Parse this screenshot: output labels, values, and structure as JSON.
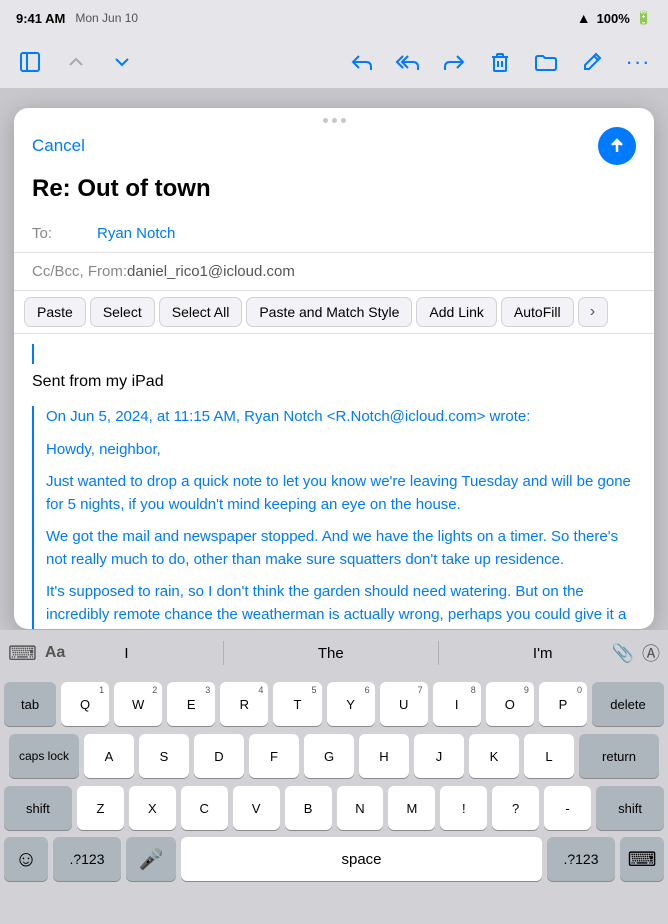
{
  "statusBar": {
    "time": "9:41 AM",
    "date": "Mon Jun 10",
    "wifi": "WiFi",
    "battery": "100%"
  },
  "toolbar": {
    "sidebarBtn": "⊟",
    "upBtn": "∧",
    "downBtn": "∨",
    "replyBtn": "↩",
    "replyAllBtn": "↩↩",
    "forwardBtn": "↪",
    "trashBtn": "🗑",
    "folderBtn": "📁",
    "composeBtn": "✏",
    "moreBtn": "⋯"
  },
  "compose": {
    "cancelLabel": "Cancel",
    "subject": "Re: Out of town",
    "toLabel": "To:",
    "toValue": "Ryan Notch",
    "ccLabel": "Cc/Bcc, From:",
    "ccValue": "daniel_rico1@icloud.com",
    "contextMenu": {
      "paste": "Paste",
      "select": "Select",
      "selectAll": "Select All",
      "pasteMatch": "Paste and Match Style",
      "addLink": "Add Link",
      "autoFill": "AutoFill",
      "chevron": "›"
    },
    "body": {
      "sentFrom": "Sent from my iPad",
      "quotedHeader": "On Jun 5, 2024, at 11:15 AM, Ryan Notch <R.Notch@icloud.com> wrote:",
      "para1": "Howdy, neighbor,",
      "para2": "Just wanted to drop a quick note to let you know we're leaving Tuesday and will be gone for 5 nights, if you wouldn't mind keeping an eye on the house.",
      "para3": "We got the mail and newspaper stopped. And we have the lights on a timer. So there's not really much to do, other than make sure squatters don't take up residence.",
      "para4": "It's supposed to rain, so I don't think the garden should need watering. But on the incredibly remote chance the weatherman is actually wrong, perhaps you could give it a quick sprinkling. Thanks. We'll see you when we get back!"
    }
  },
  "predictive": {
    "suggestion1": "I",
    "suggestion2": "The",
    "suggestion3": "I'm"
  },
  "keyboard": {
    "row1": [
      {
        "label": "Q",
        "super": "1"
      },
      {
        "label": "W",
        "super": "2"
      },
      {
        "label": "E",
        "super": "3"
      },
      {
        "label": "R",
        "super": "4"
      },
      {
        "label": "T",
        "super": "5"
      },
      {
        "label": "Y",
        "super": "6"
      },
      {
        "label": "U",
        "super": "7"
      },
      {
        "label": "I",
        "super": "8"
      },
      {
        "label": "O",
        "super": "9"
      },
      {
        "label": "P",
        "super": "0"
      }
    ],
    "row2": [
      {
        "label": "A"
      },
      {
        "label": "S"
      },
      {
        "label": "D"
      },
      {
        "label": "F"
      },
      {
        "label": "G"
      },
      {
        "label": "H"
      },
      {
        "label": "J"
      },
      {
        "label": "K"
      },
      {
        "label": "L"
      }
    ],
    "row3": [
      {
        "label": "Z"
      },
      {
        "label": "X"
      },
      {
        "label": "C"
      },
      {
        "label": "V"
      },
      {
        "label": "B"
      },
      {
        "label": "N"
      },
      {
        "label": "M"
      },
      {
        "label": "!",
        "super": ""
      },
      {
        "label": "?",
        "super": ""
      },
      {
        "label": "-",
        "super": ""
      }
    ],
    "tab": "tab",
    "capsLock": "caps lock",
    "shift": "shift",
    "delete": "delete",
    "return": "return",
    "emoji": "☺",
    "symbolMode": ".?123",
    "mic": "🎤",
    "space": "space",
    "symbolModeRight": ".?123",
    "keyboardIcon": "⌨"
  }
}
